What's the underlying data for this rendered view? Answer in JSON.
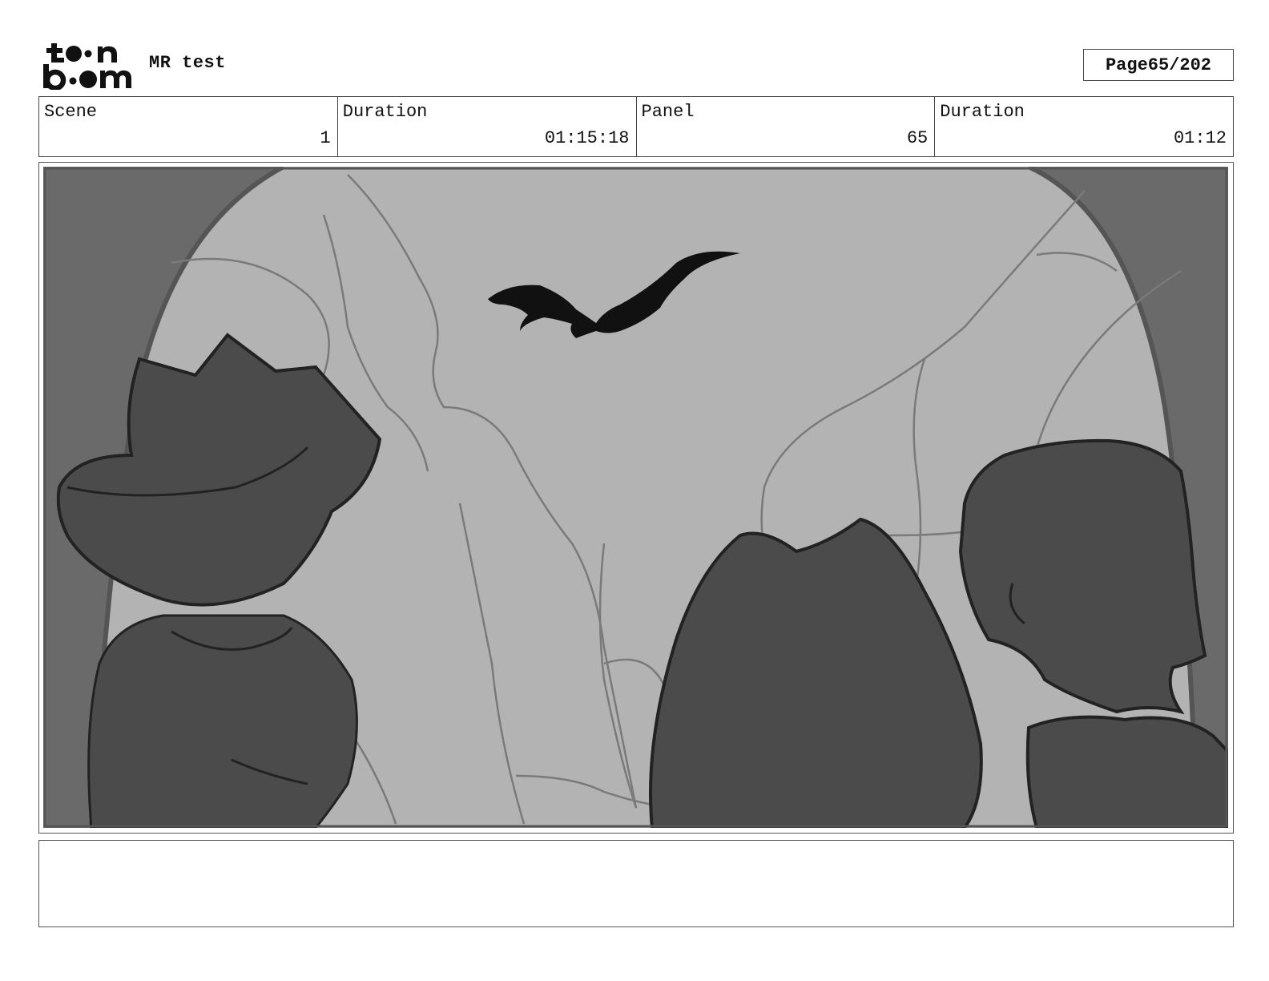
{
  "header": {
    "logo": {
      "icon": "toon-boom-logo",
      "text": "toon boom"
    },
    "project_title": "MR test",
    "page_label": "Page",
    "page_value": "65/202"
  },
  "info": {
    "scene_label": "Scene",
    "scene_value": "1",
    "scene_duration_label": "Duration",
    "scene_duration_value": "01:15:18",
    "panel_label": "Panel",
    "panel_value": "65",
    "panel_duration_label": "Duration",
    "panel_duration_value": "01:12"
  },
  "panel": {
    "image": "storyboard-sketch",
    "colors": {
      "sky": "#b3b3b3",
      "silhouette": "#4b4b4b",
      "frame": "#6a6a6a",
      "line": "#7a7a7a",
      "ink": "#111111"
    }
  },
  "notes": {
    "text": ""
  }
}
